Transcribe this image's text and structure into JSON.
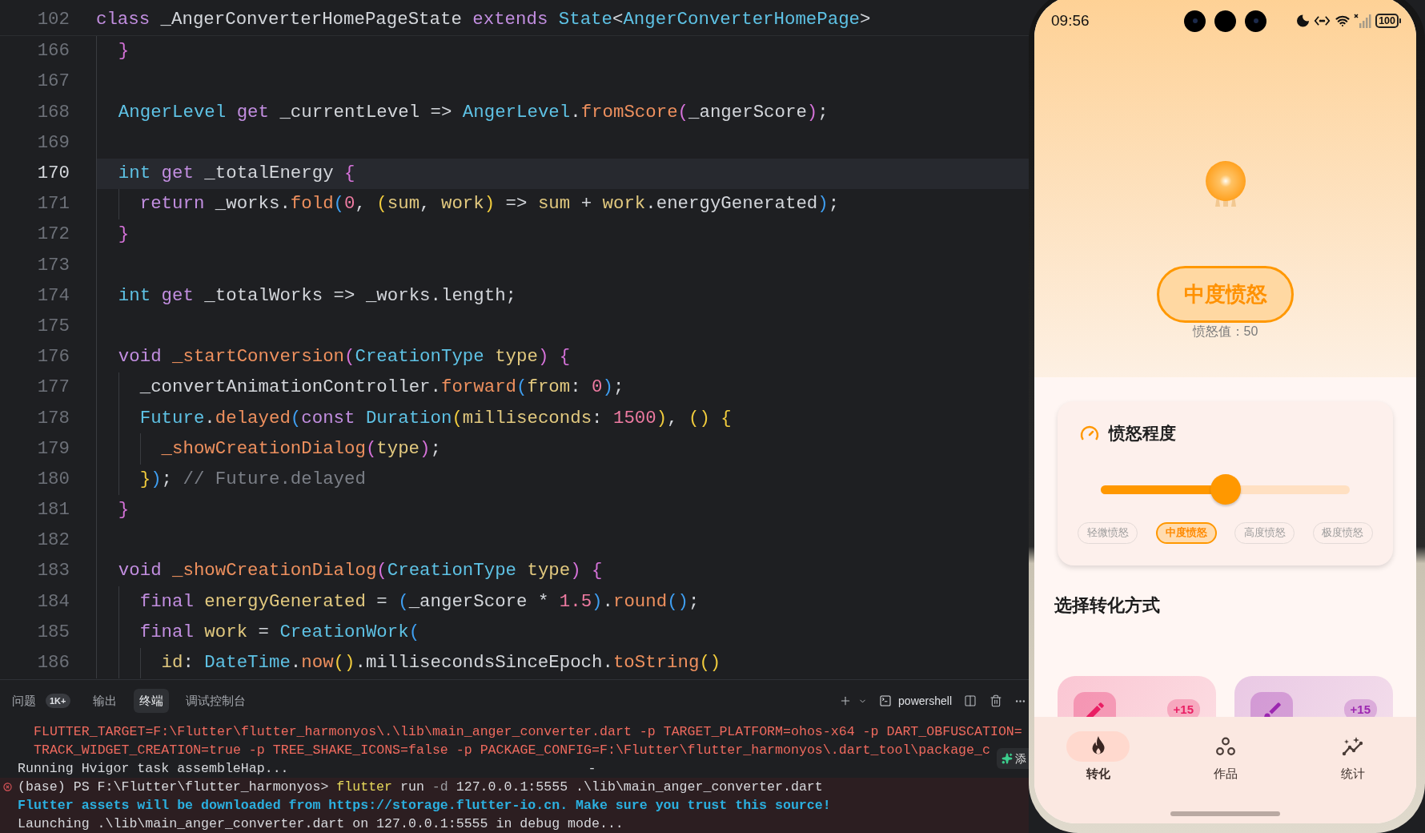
{
  "editor": {
    "sticky_line": {
      "number": "102",
      "code": [
        {
          "text": "class",
          "kind": "keyword"
        },
        {
          "text": " _AngerConverterHomePageState ",
          "kind": "plain"
        },
        {
          "text": "extends",
          "kind": "keyword"
        },
        {
          "text": " State",
          "kind": "type"
        },
        {
          "text": "<",
          "kind": "plain"
        },
        {
          "text": "AngerConverterHomePage",
          "kind": "type"
        },
        {
          "text": ">",
          "kind": "plain"
        }
      ]
    },
    "lines": [
      {
        "number": "166",
        "current": false,
        "code": [
          {
            "text": "}",
            "kind": "bracket1"
          }
        ]
      },
      {
        "number": "167",
        "current": false
      },
      {
        "number": "168",
        "current": false,
        "code": [
          {
            "text": "AngerLevel",
            "kind": "type"
          },
          {
            "text": " get",
            "kind": "keyword"
          },
          {
            "text": " _currentLevel => ",
            "kind": "plain"
          },
          {
            "text": "AngerLevel",
            "kind": "type"
          },
          {
            "text": ".",
            "kind": "plain"
          },
          {
            "text": "fromScore",
            "kind": "method"
          },
          {
            "text": "(",
            "kind": "bracket1"
          },
          {
            "text": "_angerScore",
            "kind": "plain"
          },
          {
            "text": ")",
            "kind": "bracket1"
          },
          {
            "text": ";",
            "kind": "plain"
          }
        ]
      },
      {
        "number": "169",
        "current": false
      },
      {
        "number": "170",
        "current": true,
        "code": [
          {
            "text": "int",
            "kind": "type"
          },
          {
            "text": " get",
            "kind": "keyword"
          },
          {
            "text": " _totalEnergy ",
            "kind": "plain"
          },
          {
            "text": "{",
            "kind": "bracket1"
          }
        ],
        "children": [
          {
            "number": "171",
            "current": false,
            "code": [
              {
                "text": "return",
                "kind": "keyword"
              },
              {
                "text": " _works.",
                "kind": "plain"
              },
              {
                "text": "fold",
                "kind": "method"
              },
              {
                "text": "(",
                "kind": "bracket2"
              },
              {
                "text": "0",
                "kind": "number"
              },
              {
                "text": ", ",
                "kind": "plain"
              },
              {
                "text": "(",
                "kind": "bracket3"
              },
              {
                "text": "sum",
                "kind": "param"
              },
              {
                "text": ", ",
                "kind": "plain"
              },
              {
                "text": "work",
                "kind": "param"
              },
              {
                "text": ")",
                "kind": "bracket3"
              },
              {
                "text": " => ",
                "kind": "plain"
              },
              {
                "text": "sum",
                "kind": "param"
              },
              {
                "text": " + ",
                "kind": "plain"
              },
              {
                "text": "work",
                "kind": "param"
              },
              {
                "text": ".energyGenerated",
                "kind": "plain"
              },
              {
                "text": ")",
                "kind": "bracket2"
              },
              {
                "text": ";",
                "kind": "plain"
              }
            ]
          }
        ]
      },
      {
        "number": "172",
        "current": false,
        "code": [
          {
            "text": "}",
            "kind": "bracket1"
          }
        ]
      },
      {
        "number": "173",
        "current": false
      },
      {
        "number": "174",
        "current": false,
        "code": [
          {
            "text": "int",
            "kind": "type"
          },
          {
            "text": " get",
            "kind": "keyword"
          },
          {
            "text": " _totalWorks => _works.length;",
            "kind": "plain"
          }
        ]
      },
      {
        "number": "175",
        "current": false
      },
      {
        "number": "176",
        "current": false,
        "code": [
          {
            "text": "void",
            "kind": "keyword"
          },
          {
            "text": " _startConversion",
            "kind": "method"
          },
          {
            "text": "(",
            "kind": "bracket1"
          },
          {
            "text": "CreationType",
            "kind": "type"
          },
          {
            "text": " type",
            "kind": "param"
          },
          {
            "text": ")",
            "kind": "bracket1"
          },
          {
            "text": " {",
            "kind": "bracket1"
          }
        ],
        "children": [
          {
            "number": "177",
            "current": false,
            "code": [
              {
                "text": "_convertAnimationController.",
                "kind": "plain"
              },
              {
                "text": "forward",
                "kind": "method"
              },
              {
                "text": "(",
                "kind": "bracket2"
              },
              {
                "text": "from",
                "kind": "param"
              },
              {
                "text": ": ",
                "kind": "plain"
              },
              {
                "text": "0",
                "kind": "number"
              },
              {
                "text": ")",
                "kind": "bracket2"
              },
              {
                "text": ";",
                "kind": "plain"
              }
            ]
          },
          {
            "number": "178",
            "current": false,
            "code": [
              {
                "text": "Future",
                "kind": "type"
              },
              {
                "text": ".",
                "kind": "plain"
              },
              {
                "text": "delayed",
                "kind": "method"
              },
              {
                "text": "(",
                "kind": "bracket2"
              },
              {
                "text": "const",
                "kind": "keyword"
              },
              {
                "text": " Duration",
                "kind": "type"
              },
              {
                "text": "(",
                "kind": "bracket3"
              },
              {
                "text": "milliseconds",
                "kind": "param"
              },
              {
                "text": ": ",
                "kind": "plain"
              },
              {
                "text": "1500",
                "kind": "number"
              },
              {
                "text": ")",
                "kind": "bracket3"
              },
              {
                "text": ", ",
                "kind": "plain"
              },
              {
                "text": "()",
                "kind": "bracket3"
              },
              {
                "text": " {",
                "kind": "bracket3"
              }
            ],
            "children": [
              {
                "number": "179",
                "current": false,
                "code": [
                  {
                    "text": "_showCreationDialog",
                    "kind": "method"
                  },
                  {
                    "text": "(",
                    "kind": "bracket1"
                  },
                  {
                    "text": "type",
                    "kind": "param"
                  },
                  {
                    "text": ")",
                    "kind": "bracket1"
                  },
                  {
                    "text": ";",
                    "kind": "plain"
                  }
                ]
              }
            ]
          },
          {
            "number": "180",
            "current": false,
            "code": [
              {
                "text": "}",
                "kind": "bracket3"
              },
              {
                "text": ")",
                "kind": "bracket2"
              },
              {
                "text": "; ",
                "kind": "plain"
              },
              {
                "text": "// Future.delayed",
                "kind": "comment"
              }
            ]
          }
        ]
      },
      {
        "number": "181",
        "current": false,
        "code": [
          {
            "text": "}",
            "kind": "bracket1"
          }
        ]
      },
      {
        "number": "182",
        "current": false
      },
      {
        "number": "183",
        "current": false,
        "code": [
          {
            "text": "void",
            "kind": "keyword"
          },
          {
            "text": " _showCreationDialog",
            "kind": "method"
          },
          {
            "text": "(",
            "kind": "bracket1"
          },
          {
            "text": "CreationType",
            "kind": "type"
          },
          {
            "text": " type",
            "kind": "param"
          },
          {
            "text": ")",
            "kind": "bracket1"
          },
          {
            "text": " {",
            "kind": "bracket1"
          }
        ],
        "children": [
          {
            "number": "184",
            "current": false,
            "code": [
              {
                "text": "final",
                "kind": "keyword"
              },
              {
                "text": " energyGenerated",
                "kind": "param"
              },
              {
                "text": " = ",
                "kind": "plain"
              },
              {
                "text": "(",
                "kind": "bracket2"
              },
              {
                "text": "_angerScore * ",
                "kind": "plain"
              },
              {
                "text": "1.5",
                "kind": "number"
              },
              {
                "text": ")",
                "kind": "bracket2"
              },
              {
                "text": ".",
                "kind": "plain"
              },
              {
                "text": "round",
                "kind": "method"
              },
              {
                "text": "()",
                "kind": "bracket2"
              },
              {
                "text": ";",
                "kind": "plain"
              }
            ]
          },
          {
            "number": "185",
            "current": false,
            "code": [
              {
                "text": "final",
                "kind": "keyword"
              },
              {
                "text": " work",
                "kind": "param"
              },
              {
                "text": " = ",
                "kind": "plain"
              },
              {
                "text": "CreationWork",
                "kind": "type"
              },
              {
                "text": "(",
                "kind": "bracket2"
              }
            ],
            "children": [
              {
                "number": "186",
                "current": false,
                "code": [
                  {
                    "text": "id",
                    "kind": "param"
                  },
                  {
                    "text": ": ",
                    "kind": "plain"
                  },
                  {
                    "text": "DateTime",
                    "kind": "type"
                  },
                  {
                    "text": ".",
                    "kind": "plain"
                  },
                  {
                    "text": "now",
                    "kind": "method"
                  },
                  {
                    "text": "()",
                    "kind": "bracket3"
                  },
                  {
                    "text": ".millisecondsSinceEpoch.",
                    "kind": "plain"
                  },
                  {
                    "text": "toString",
                    "kind": "method"
                  },
                  {
                    "text": "()",
                    "kind": "bracket3"
                  }
                ]
              }
            ]
          }
        ]
      }
    ]
  },
  "terminal": {
    "tabs": [
      {
        "label": "问题",
        "badge": "1K+",
        "selected": false
      },
      {
        "label": "输出",
        "selected": false
      },
      {
        "label": "终端",
        "selected": true
      },
      {
        "label": "调试控制台",
        "selected": false
      }
    ],
    "shell": "powershell",
    "lines": [
      {
        "kind": "error",
        "text": "FLUTTER_TARGET=F:\\Flutter\\flutter_harmonyos\\.\\lib\\main_anger_converter.dart -p TARGET_PLATFORM=ohos-x64 -p DART_OBFUSCATION="
      },
      {
        "kind": "error",
        "text": "TRACK_WIDGET_CREATION=true -p TREE_SHAKE_ICONS=false -p PACKAGE_CONFIG=F:\\Flutter\\flutter_harmonyos\\.dart_tool\\package_c"
      },
      {
        "kind": "plain",
        "text": "Running Hvigor task assembleHap...",
        "spinner": "-"
      }
    ],
    "command": {
      "failed": true,
      "segments": [
        {
          "text": "(base) PS F:\\Flutter\\flutter_harmonyos> ",
          "kind": "plain"
        },
        {
          "text": "flutter",
          "kind": "command"
        },
        {
          "text": " run ",
          "kind": "plain"
        },
        {
          "text": "-d",
          "kind": "flag"
        },
        {
          "text": " 127.0.0.1:5555 .\\lib\\main_anger_converter.dart",
          "kind": "plain"
        }
      ],
      "output": [
        {
          "kind": "info",
          "text": "Flutter assets will be downloaded from https://storage.flutter-io.cn. Make sure you trust this source!"
        },
        {
          "kind": "plain",
          "text": "Launching .\\lib\\main_anger_converter.dart on 127.0.0.1:5555 in debug mode..."
        }
      ]
    },
    "assistant_button": {
      "label": "添"
    }
  },
  "phone": {
    "status_bar": {
      "time": "09:56",
      "battery": "100"
    },
    "anger_level": {
      "label": "中度愤怒",
      "value_text": "愤怒值：50"
    },
    "intensity_card": {
      "title": "愤怒程度",
      "level": 0.5,
      "options": [
        {
          "label": "轻微愤怒",
          "selected": false
        },
        {
          "label": "中度愤怒",
          "selected": true
        },
        {
          "label": "高度愤怒",
          "selected": false
        },
        {
          "label": "极度愤怒",
          "selected": false
        }
      ]
    },
    "section_title": "选择转化方式",
    "methods": [
      {
        "badge": "+15",
        "color": "#e91e63"
      },
      {
        "badge": "+15",
        "color": "#9c27b0"
      }
    ],
    "nav": [
      {
        "label": "转化",
        "selected": true
      },
      {
        "label": "作品",
        "selected": false
      },
      {
        "label": "统计",
        "selected": false
      }
    ]
  }
}
